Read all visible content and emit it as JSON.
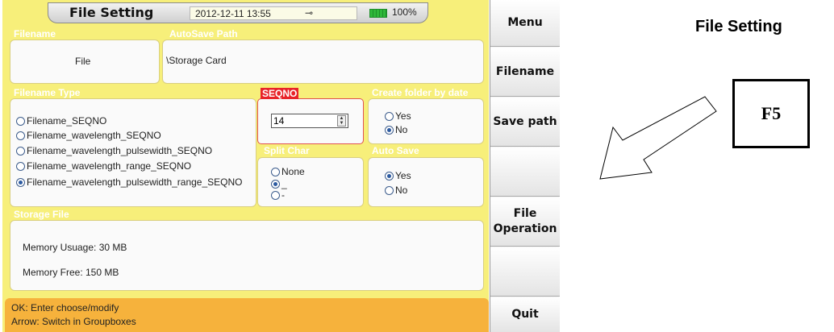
{
  "status_bar": {
    "title": "File Setting",
    "datetime": "2012-12-11 13:55",
    "battery": "100%",
    "plug_icon": "plug-icon",
    "battery_icon": "battery-icon"
  },
  "filename_group": {
    "label": "Filename",
    "value": "File"
  },
  "autosave_path_group": {
    "label": "AutoSave Path",
    "value": "\\Storage Card"
  },
  "filename_type": {
    "label": "Filename Type",
    "options": [
      "Filename_SEQNO",
      "Filename_wavelength_SEQNO",
      "Filename_wavelength_pulsewidth_SEQNO",
      "Filename_wavelength_range_SEQNO",
      "Filename_wavelength_pulsewidth_range_SEQNO"
    ],
    "selected": 4
  },
  "seqno": {
    "label": "SEQNO",
    "value": "14"
  },
  "create_folder": {
    "label": "Create folder by date",
    "options": [
      "Yes",
      "No"
    ],
    "selected": 1
  },
  "split_char": {
    "label": "Split Char",
    "options": [
      "None",
      "_",
      "-"
    ],
    "selected": 1
  },
  "auto_save": {
    "label": "Auto Save",
    "options": [
      "Yes",
      "No"
    ],
    "selected": 0
  },
  "storage_file": {
    "label": "Storage File",
    "memory_usage": "Memory Usuage: 30 MB",
    "memory_free": "Memory Free: 150 MB"
  },
  "footer": {
    "line1": "OK: Enter choose/modify",
    "line2": "Arrow: Switch in Groupboxes"
  },
  "sidebar": {
    "menu": "Menu",
    "filename": "Filename",
    "save_path": "Save path",
    "empty1": "",
    "file_operation": "File Operation",
    "empty2": "",
    "quit": "Quit"
  },
  "annotation": {
    "title": "File Setting",
    "key": "F5"
  }
}
